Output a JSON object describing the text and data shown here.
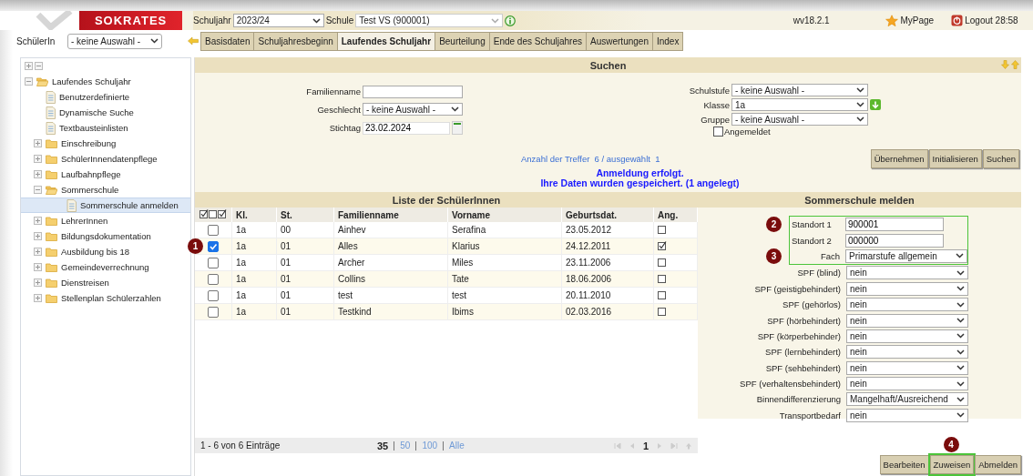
{
  "header": {
    "logo": "SOKRATES",
    "school_year_label": "Schuljahr",
    "school_year": "2023/24",
    "school_label": "Schule",
    "school": "Test VS (900001)",
    "version": "wv18.2.1",
    "mypage": "MyPage",
    "logout": "Logout 28:58"
  },
  "student_select": {
    "label": "SchülerIn",
    "value": "- keine Auswahl -"
  },
  "tabs": [
    {
      "label": "Basisdaten",
      "selected": false
    },
    {
      "label": "Schuljahresbeginn",
      "selected": false
    },
    {
      "label": "Laufendes Schuljahr",
      "selected": true
    },
    {
      "label": "Beurteilung",
      "selected": false
    },
    {
      "label": "Ende des Schuljahres",
      "selected": false
    },
    {
      "label": "Auswertungen",
      "selected": false
    },
    {
      "label": "Index",
      "selected": false
    }
  ],
  "tree": [
    {
      "label": "Laufendes Schuljahr",
      "kind": "folder",
      "expanded": true,
      "selected": false,
      "children": [
        {
          "label": "Benutzerdefinierte",
          "kind": "page",
          "selected": false
        },
        {
          "label": "Dynamische Suche",
          "kind": "page",
          "selected": false
        },
        {
          "label": "Textbausteinlisten",
          "kind": "page",
          "selected": false
        },
        {
          "label": "Einschreibung",
          "kind": "folder",
          "expanded": false,
          "selected": false
        },
        {
          "label": "SchülerInnendatenpflege",
          "kind": "folder",
          "expanded": false,
          "selected": false
        },
        {
          "label": "Laufbahnpflege",
          "kind": "folder",
          "expanded": false,
          "selected": false
        },
        {
          "label": "Sommerschule",
          "kind": "folder",
          "expanded": true,
          "selected": false,
          "children": [
            {
              "label": "Sommerschule anmelden",
              "kind": "page",
              "selected": true
            }
          ]
        },
        {
          "label": "LehrerInnen",
          "kind": "folder",
          "expanded": false,
          "selected": false
        },
        {
          "label": "Bildungsdokumentation",
          "kind": "folder",
          "expanded": false,
          "selected": false
        },
        {
          "label": "Ausbildung bis 18",
          "kind": "folder",
          "expanded": false,
          "selected": false
        },
        {
          "label": "Gemeindeverrechnung",
          "kind": "folder",
          "expanded": false,
          "selected": false
        },
        {
          "label": "Dienstreisen",
          "kind": "folder",
          "expanded": false,
          "selected": false
        },
        {
          "label": "Stellenplan Schülerzahlen",
          "kind": "folder",
          "expanded": false,
          "selected": false
        }
      ]
    }
  ],
  "search": {
    "title": "Suchen",
    "left_fields": [
      {
        "label": "Familienname",
        "kind": "text"
      },
      {
        "label": "Geschlecht",
        "kind": "select",
        "value": "- keine Auswahl -"
      },
      {
        "label": "Stichtag",
        "kind": "date",
        "value": "23.02.2024"
      }
    ],
    "right_fields": [
      {
        "label": "Schulstufe",
        "kind": "select",
        "value": "- keine Auswahl -"
      },
      {
        "label": "Klasse",
        "kind": "select",
        "value": "1a",
        "apply_icon": true
      },
      {
        "label": "Gruppe",
        "kind": "select",
        "value": "- keine Auswahl -"
      }
    ],
    "checkbox": {
      "label": "Angemeldet",
      "checked": false
    },
    "hits": "Anzahl der Treffer  6 / ausgewählt  1",
    "buttons": [
      "Übernehmen",
      "Initialisieren",
      "Suchen"
    ],
    "messages": [
      "Anmeldung erfolgt.",
      "Ihre Daten wurden gespeichert. (1 angelegt)"
    ]
  },
  "list": {
    "title": "Liste der SchülerInnen",
    "columns": [
      "Kl.",
      "St.",
      "Familienname",
      "Vorname",
      "Geburtsdat.",
      "Ang."
    ],
    "rows": [
      {
        "selected": false,
        "registered": false,
        "cells": [
          "1a",
          "00",
          "Ainhev",
          "Serafina",
          "23.05.2012"
        ]
      },
      {
        "selected": true,
        "registered": true,
        "marker": "1",
        "cells": [
          "1a",
          "01",
          "Alles",
          "Klarius",
          "24.12.2011"
        ]
      },
      {
        "selected": false,
        "registered": false,
        "cells": [
          "1a",
          "01",
          "Archer",
          "Miles",
          "23.11.2006"
        ]
      },
      {
        "selected": false,
        "registered": false,
        "cells": [
          "1a",
          "01",
          "Collins",
          "Tate",
          "18.06.2006"
        ]
      },
      {
        "selected": false,
        "registered": false,
        "cells": [
          "1a",
          "01",
          "test",
          "test",
          "20.11.2010"
        ]
      },
      {
        "selected": false,
        "registered": false,
        "cells": [
          "1a",
          "01",
          "Testkind",
          "Ibims",
          "02.03.2016"
        ]
      }
    ],
    "footer": {
      "range": "1 - 6 von 6 Einträge",
      "page_sizes": [
        {
          "label": "35",
          "selected": true
        },
        {
          "label": "50",
          "selected": false
        },
        {
          "label": "100",
          "selected": false
        },
        {
          "label": "Alle",
          "selected": false
        }
      ],
      "page": "1"
    }
  },
  "form": {
    "title": "Sommerschule melden",
    "fields": [
      {
        "label": "Standort 1",
        "kind": "input",
        "value": "900001",
        "highlighted": true,
        "marker": "2"
      },
      {
        "label": "Standort 2",
        "kind": "input",
        "value": "000000",
        "highlighted": true
      },
      {
        "label": "Fach",
        "kind": "select",
        "value": "Primarstufe allgemein",
        "highlighted": true,
        "marker": "3"
      },
      {
        "label": "SPF (blind)",
        "kind": "select",
        "value": "nein",
        "highlighted": false
      },
      {
        "label": "SPF (geistigbehindert)",
        "kind": "select",
        "value": "nein",
        "highlighted": false
      },
      {
        "label": "SPF (gehörlos)",
        "kind": "select",
        "value": "nein",
        "highlighted": false
      },
      {
        "label": "SPF (hörbehindert)",
        "kind": "select",
        "value": "nein",
        "highlighted": false
      },
      {
        "label": "SPF (körperbehinder)",
        "kind": "select",
        "value": "nein",
        "highlighted": false
      },
      {
        "label": "SPF (lernbehindert)",
        "kind": "select",
        "value": "nein",
        "highlighted": false
      },
      {
        "label": "SPF (sehbehindert)",
        "kind": "select",
        "value": "nein",
        "highlighted": false
      },
      {
        "label": "SPF (verhaltensbehindert)",
        "kind": "select",
        "value": "nein",
        "highlighted": false
      },
      {
        "label": "Binnendifferenzierung",
        "kind": "select",
        "value": "Mangelhaft/Ausreichend",
        "highlighted": false
      },
      {
        "label": "Transportbedarf",
        "kind": "select",
        "value": "nein",
        "highlighted": false
      }
    ],
    "buttons": [
      {
        "label": "Bearbeiten",
        "highlighted": false
      },
      {
        "label": "Zuweisen",
        "highlighted": true,
        "marker": "4"
      },
      {
        "label": "Abmelden",
        "highlighted": false
      }
    ]
  }
}
